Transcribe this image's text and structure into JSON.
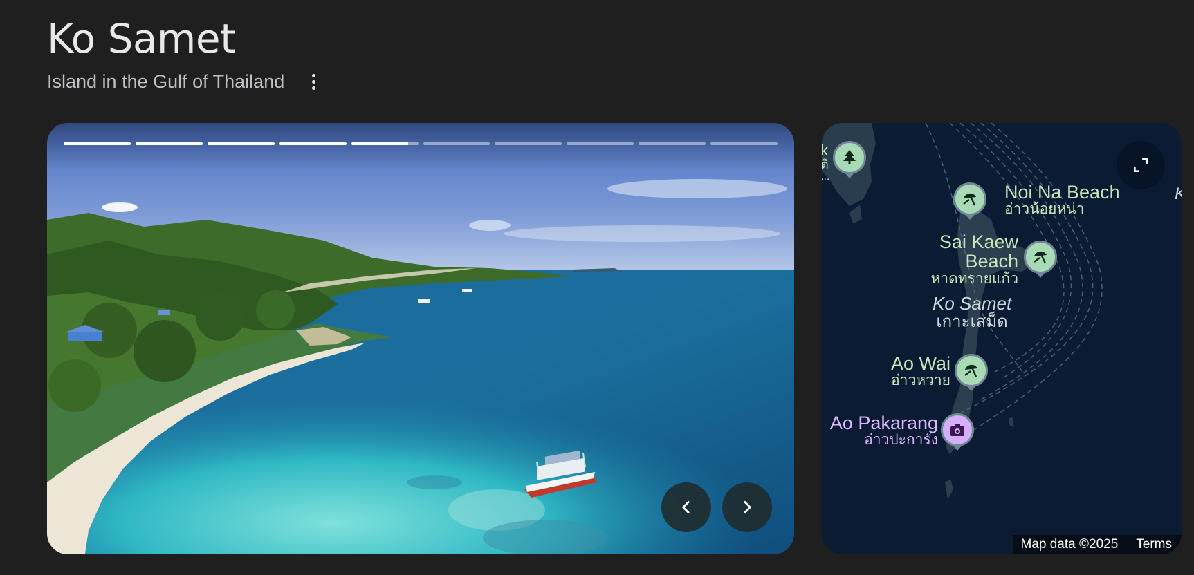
{
  "header": {
    "title": "Ko Samet",
    "subtitle": "Island in the Gulf of Thailand"
  },
  "carousel": {
    "total_photos": 10,
    "current_index": 4,
    "current_progress": 0.85
  },
  "map": {
    "places": [
      {
        "name": "Noi Na Beach",
        "thai": "อ่าวน้อยหน่า",
        "icon": "beach-icon"
      },
      {
        "name_lines": [
          "Sai Kaew",
          "Beach"
        ],
        "thai": "หาดทรายแก้ว",
        "icon": "beach-icon"
      },
      {
        "name": "Ko Samet",
        "thai": "เกาะเสม็ด"
      },
      {
        "name": "Ao Wai",
        "thai": "อ่าวหวาย",
        "icon": "beach-icon"
      },
      {
        "name": "Ao Pakarang",
        "thai": "อ่าวปะการัง",
        "icon": "camera-icon"
      }
    ],
    "partial_labels": [
      "k",
      "ติ",
      "...",
      "K"
    ],
    "footer": {
      "attribution": "Map data ©2025",
      "terms": "Terms"
    }
  },
  "colors": {
    "background": "#1f1f1f",
    "map_water": "#0a1b33",
    "pin_green": "#a8dab5",
    "pin_purple": "#d7aefb",
    "label_green": "#c4e6b8",
    "label_purple": "#e1b7ff"
  }
}
